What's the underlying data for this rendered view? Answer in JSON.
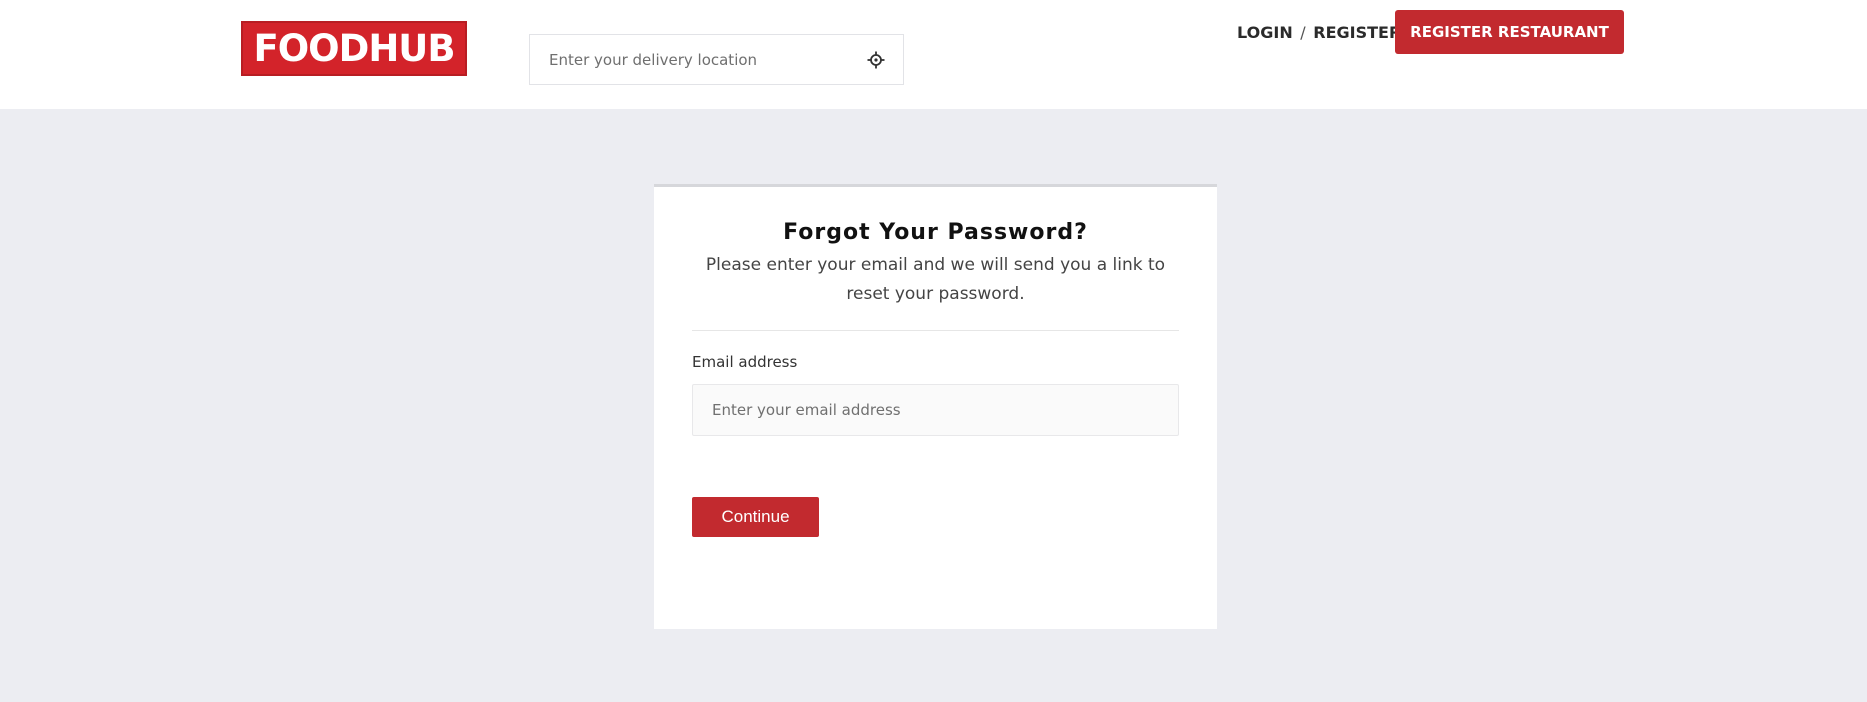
{
  "header": {
    "logo_text": "FOODHUB",
    "location": {
      "placeholder": "Enter your delivery location",
      "value": "",
      "icon": "crosshair-locate-icon"
    },
    "login_label": "LOGIN",
    "separator": "/",
    "register_label": "REGISTER",
    "register_restaurant_label": "REGISTER RESTAURANT"
  },
  "card": {
    "title": "Forgot Your Password?",
    "subtitle": "Please enter your email and we will send you a link to reset your password.",
    "email_label": "Email address",
    "email_placeholder": "Enter your email address",
    "email_value": "",
    "continue_label": "Continue"
  },
  "colors": {
    "brand_red": "#d3232a",
    "button_red": "#c22a2f",
    "page_background": "#ecedf2",
    "header_background": "#ffffff"
  }
}
